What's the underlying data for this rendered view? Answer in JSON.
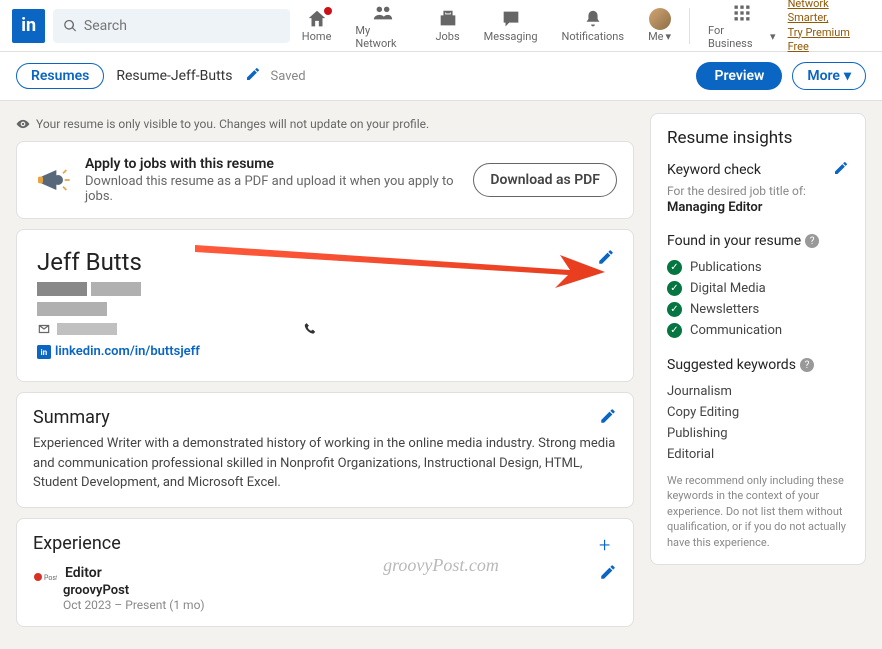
{
  "nav": {
    "search_placeholder": "Search",
    "items": [
      {
        "label": "Home"
      },
      {
        "label": "My Network"
      },
      {
        "label": "Jobs"
      },
      {
        "label": "Messaging"
      },
      {
        "label": "Notifications"
      },
      {
        "label": "Me"
      },
      {
        "label": "For Business"
      }
    ],
    "premium_line1": "Network Smarter,",
    "premium_line2": "Try Premium Free"
  },
  "subnav": {
    "resumes_label": "Resumes",
    "filename": "Resume-Jeff-Butts",
    "saved": "Saved",
    "preview": "Preview",
    "more": "More"
  },
  "notice": "Your resume is only visible to you. Changes will not update on your profile.",
  "banner": {
    "title": "Apply to jobs with this resume",
    "subtitle": "Download this resume as a PDF and upload it when you apply to jobs.",
    "button": "Download as PDF"
  },
  "profile": {
    "name": "Jeff Butts",
    "url_label": "linkedin.com/in/buttsjeff"
  },
  "summary": {
    "title": "Summary",
    "text": "Experienced Writer with a demonstrated history of working in the online media industry. Strong media and communication professional skilled in Nonprofit Organizations, Instructional Design, HTML, Student Development, and Microsoft Excel."
  },
  "experience": {
    "title": "Experience",
    "job_title": "Editor",
    "company": "groovyPost",
    "dates": "Oct 2023 – Present (1 mo)"
  },
  "insights": {
    "title": "Resume insights",
    "keyword_check": "Keyword check",
    "desired_label": "For the desired job title of:",
    "desired_job": "Managing Editor",
    "found_title": "Found in your resume",
    "found": [
      "Publications",
      "Digital Media",
      "Newsletters",
      "Communication"
    ],
    "suggested_title": "Suggested keywords",
    "suggested": [
      "Journalism",
      "Copy Editing",
      "Publishing",
      "Editorial"
    ],
    "suggested_note": "We recommend only including these keywords in the context of your experience. Do not list them without qualification, or if you do not actually have this experience."
  },
  "watermark": "groovyPost.com"
}
